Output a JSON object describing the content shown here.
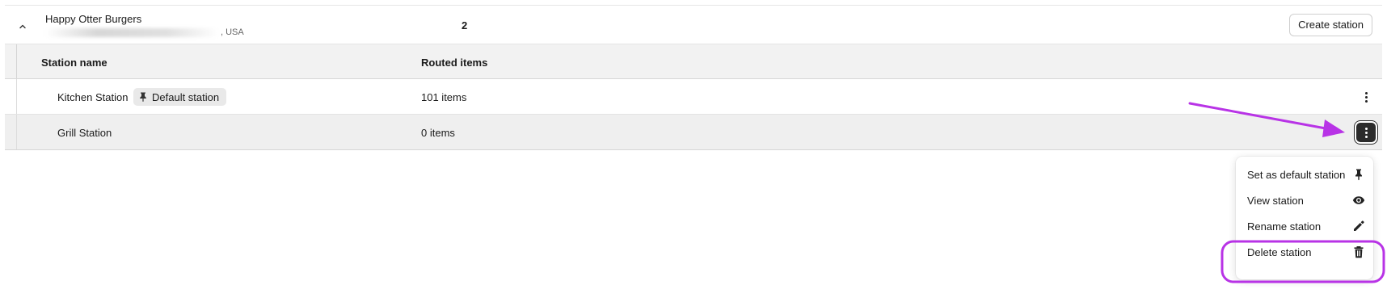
{
  "location": {
    "name": "Happy Otter Burgers",
    "address_suffix": ", USA",
    "station_count": "2",
    "create_button_label": "Create station"
  },
  "table": {
    "headers": {
      "station_name": "Station name",
      "routed_items": "Routed items"
    },
    "rows": [
      {
        "name": "Kitchen Station",
        "badge": "Default station",
        "routed": "101 items"
      },
      {
        "name": "Grill Station",
        "badge": "",
        "routed": "0 items"
      }
    ]
  },
  "menu": {
    "items": [
      {
        "label": "Set as default station",
        "icon": "pin-icon"
      },
      {
        "label": "View station",
        "icon": "eye-icon"
      },
      {
        "label": "Rename station",
        "icon": "pencil-icon"
      },
      {
        "label": "Delete station",
        "icon": "trash-icon"
      }
    ]
  },
  "colors": {
    "annotation": "#b833e6",
    "active_button": "#2b2b2b",
    "header_bg": "#f2f2f2",
    "selected_row_bg": "#efefef"
  }
}
